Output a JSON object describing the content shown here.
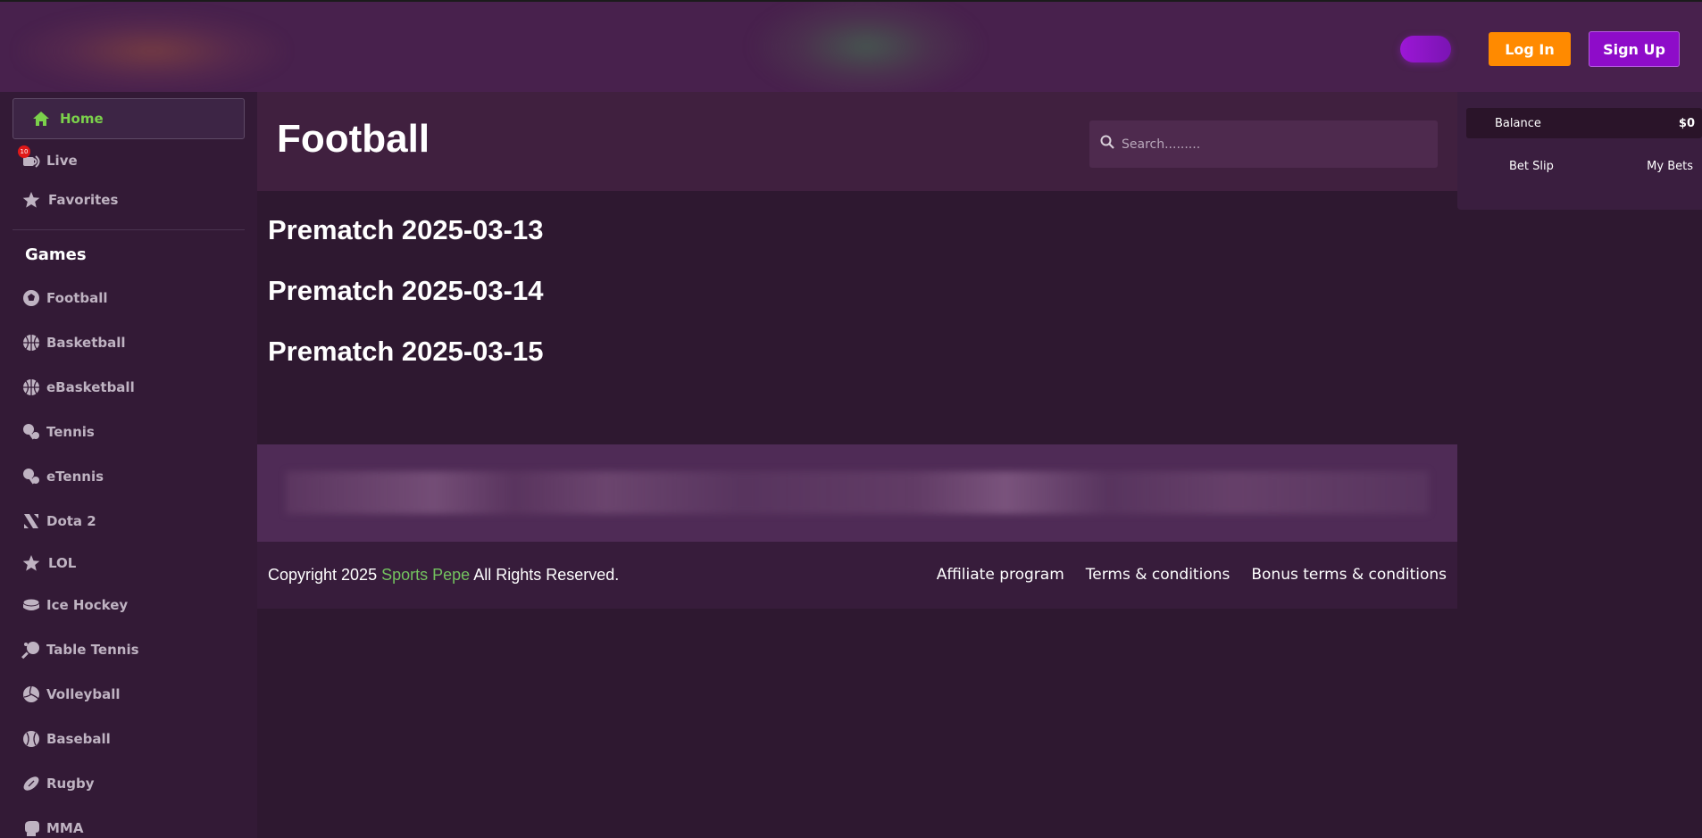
{
  "header": {
    "login_label": "Log In",
    "signup_label": "Sign Up",
    "theme_toggle": "theme-toggle"
  },
  "sidebar": {
    "home": {
      "label": "Home",
      "icon": "home-icon"
    },
    "live": {
      "label": "Live",
      "icon": "live-icon",
      "badge": "10"
    },
    "favorites": {
      "label": "Favorites",
      "icon": "star-icon"
    },
    "games_title": "Games",
    "games": [
      {
        "label": "Football",
        "icon": "football-icon"
      },
      {
        "label": "Basketball",
        "icon": "basketball-icon"
      },
      {
        "label": "eBasketball",
        "icon": "ebasketball-icon"
      },
      {
        "label": "Tennis",
        "icon": "tennis-icon"
      },
      {
        "label": "eTennis",
        "icon": "etennis-icon"
      },
      {
        "label": "Dota 2",
        "icon": "dota2-icon"
      },
      {
        "label": "LOL",
        "icon": "lol-icon"
      },
      {
        "label": "Ice Hockey",
        "icon": "ice-hockey-icon"
      },
      {
        "label": "Table Tennis",
        "icon": "table-tennis-icon"
      },
      {
        "label": "Volleyball",
        "icon": "volleyball-icon"
      },
      {
        "label": "Baseball",
        "icon": "baseball-icon"
      },
      {
        "label": "Rugby",
        "icon": "rugby-icon"
      },
      {
        "label": "MMA",
        "icon": "mma-icon"
      }
    ]
  },
  "main": {
    "title": "Football",
    "search_placeholder": "Search.........",
    "prematch": [
      "Prematch 2025-03-13",
      "Prematch 2025-03-14",
      "Prematch 2025-03-15"
    ]
  },
  "footer": {
    "copyright_prefix": "Copyright 2025",
    "brand": "Sports Pepe",
    "copyright_suffix": "All Rights Reserved.",
    "links": [
      "Affiliate program",
      "Terms & conditions",
      "Bonus terms & conditions"
    ]
  },
  "right_panel": {
    "balance_label": "Balance",
    "balance_value": "$0",
    "tabs": [
      "Bet Slip",
      "My Bets"
    ]
  },
  "colors": {
    "accent_green": "#7bd14b",
    "login_orange": "#ff8a00",
    "signup_purple": "#8e0cc9",
    "background": "#2e1830"
  }
}
